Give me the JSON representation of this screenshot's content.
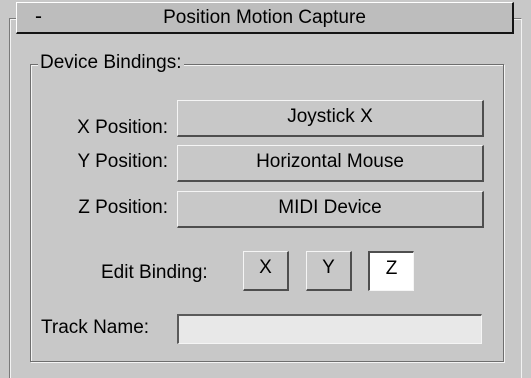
{
  "rollout": {
    "collapse_symbol": "-",
    "title": "Position Motion Capture"
  },
  "device_bindings": {
    "group_label": "Device Bindings:",
    "rows": [
      {
        "label": "X Position:",
        "value": "Joystick X"
      },
      {
        "label": "Y Position:",
        "value": "Horizontal Mouse"
      },
      {
        "label": "Z Position:",
        "value": "MIDI Device"
      }
    ],
    "edit_binding": {
      "label": "Edit Binding:",
      "buttons": [
        "X",
        "Y",
        "Z"
      ],
      "active": "Z"
    },
    "track_name": {
      "label": "Track Name:",
      "value": ""
    }
  }
}
